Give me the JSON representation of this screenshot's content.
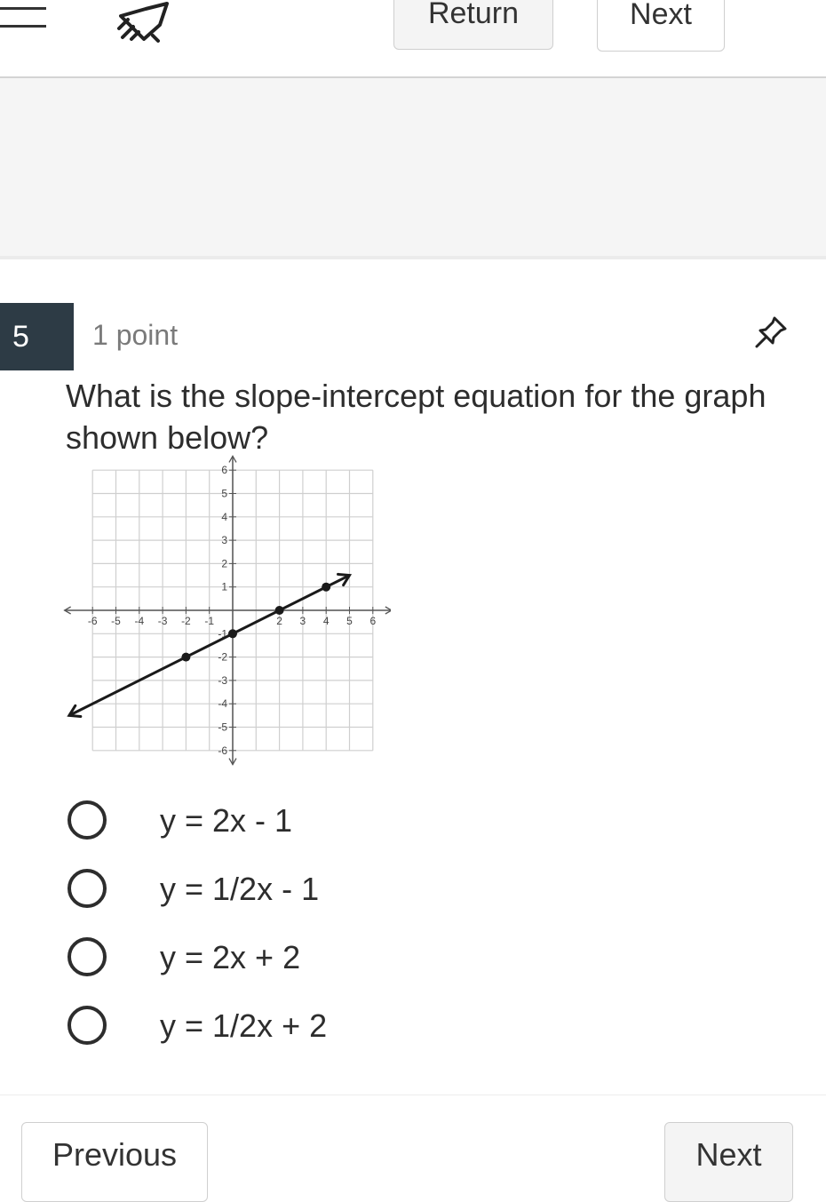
{
  "header": {
    "return_label": "Return",
    "next_label": "Next",
    "menu_icon": "hamburger-menu-icon",
    "app_icon": "rocket-icon"
  },
  "question": {
    "number": "5",
    "points": "1 point",
    "text": "What is the slope-intercept equation for the graph shown below?",
    "pin_icon": "pushpin-icon"
  },
  "graph": {
    "x_ticks": [
      "-6",
      "-5",
      "-4",
      "-3",
      "-2",
      "-1",
      "2",
      "3",
      "4",
      "5",
      "6"
    ],
    "y_ticks": [
      "6",
      "5",
      "4",
      "3",
      "2",
      "1",
      "-1",
      "-2",
      "-3",
      "-4",
      "-5",
      "-6"
    ],
    "x_range": [
      -6,
      6
    ],
    "y_range": [
      -6,
      6
    ],
    "line": {
      "slope": 0.5,
      "intercept": -1,
      "x_start": -7,
      "x_end": 5
    },
    "points": [
      {
        "x": -2,
        "y": -2
      },
      {
        "x": 0,
        "y": -1
      },
      {
        "x": 2,
        "y": 0
      },
      {
        "x": 4,
        "y": 1
      }
    ]
  },
  "options": [
    {
      "label": "y = 2x - 1"
    },
    {
      "label": "y = 1/2x - 1"
    },
    {
      "label": "y = 2x + 2"
    },
    {
      "label": "y = 1/2x + 2"
    }
  ],
  "footer": {
    "previous_label": "Previous",
    "next_label": "Next"
  }
}
